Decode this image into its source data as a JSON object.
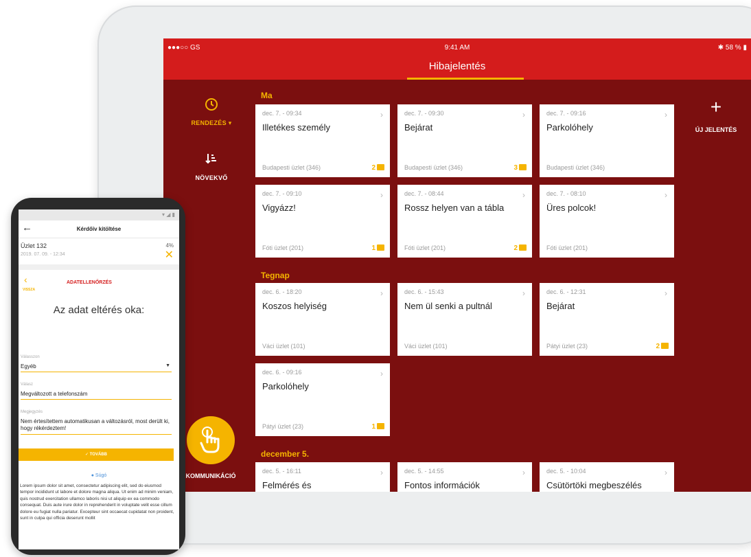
{
  "tablet": {
    "status": {
      "carrier": "●●●○○ GS",
      "time": "9:41 AM",
      "battery": "58 %"
    },
    "title": "Hibajelentés",
    "rail": {
      "sort_label": "RENDEZÉS",
      "order_label": "NÖVEKVŐ",
      "communication_label": "KOMMUNIKÁCIÓ"
    },
    "new_report_label": "ÚJ JELENTÉS",
    "sections": [
      {
        "heading": "Ma",
        "cards": [
          {
            "date": "dec. 7. - 09:34",
            "title": "Illetékes személy",
            "store": "Budapesti üzlet (346)",
            "badge": "2"
          },
          {
            "date": "dec. 7. - 09:30",
            "title": "Bejárat",
            "store": "Budapesti üzlet (346)",
            "badge": "3"
          },
          {
            "date": "dec. 7. - 09:16",
            "title": "Parkolóhely",
            "store": "Budapesti üzlet (346)",
            "badge": ""
          },
          {
            "date": "dec. 7. - 09:10",
            "title": "Vigyázz!",
            "store": "Fóti üzlet (201)",
            "badge": "1"
          },
          {
            "date": "dec. 7. - 08:44",
            "title": "Rossz helyen van a tábla",
            "store": "Fóti üzlet (201)",
            "badge": "2"
          },
          {
            "date": "dec. 7. - 08:10",
            "title": "Üres polcok!",
            "store": "Fóti üzlet (201)",
            "badge": ""
          }
        ]
      },
      {
        "heading": "Tegnap",
        "cards": [
          {
            "date": "dec. 6. - 18:20",
            "title": "Koszos helyiség",
            "store": "Váci üzlet (101)",
            "badge": ""
          },
          {
            "date": "dec. 6. - 15:43",
            "title": "Nem ül senki a pultnál",
            "store": "Váci üzlet (101)",
            "badge": ""
          },
          {
            "date": "dec. 6. - 12:31",
            "title": "Bejárat",
            "store": "Pátyi üzlet (23)",
            "badge": "2"
          },
          {
            "date": "dec. 6. - 09:16",
            "title": "Parkolóhely",
            "store": "Pátyi üzlet (23)",
            "badge": "1"
          }
        ]
      },
      {
        "heading": "december 5.",
        "cards": [
          {
            "date": "dec. 5. - 16:11",
            "title": "Felmérés és",
            "store": "",
            "badge": ""
          },
          {
            "date": "dec. 5. - 14:55",
            "title": "Fontos információk",
            "store": "",
            "badge": ""
          },
          {
            "date": "dec. 5. - 10:04",
            "title": "Csütörtöki megbeszélés",
            "store": "",
            "badge": ""
          }
        ]
      }
    ]
  },
  "phone": {
    "header_title": "Kérdőív kitöltése",
    "store": "Üzlet 132",
    "progress": "4%",
    "timestamp": "2019. 07. 09. - 12:34",
    "back_label": "VISSZA",
    "step_title": "ADATELLENŐRZÉS",
    "question": "Az adat eltérés oka:",
    "select_label": "Válasszon",
    "select_value": "Egyéb",
    "answer_label": "Válasz",
    "answer_value": "Megváltozott a telefonszám",
    "note_label": "Megjegyzés",
    "note_value": "Nem értesítettem automatikusan a változásról, most derült ki, hogy rékérdeztem!",
    "next_button": "✓ TOVÁBB",
    "help_label": "Súgó",
    "lorem": "Lorem ipsum dolor sit amet, consectetur adipiscing elit, sed do eiusmod tempor incididunt ut labore et dolore magna aliqua. Ut enim ad minim veniam, quis nostrud exercitation ullamco laboris nisi ut aliquip ex ea commodo consequat. Duis aute irure dolor in reprehenderit in voluptate velit esse cillum dolore eu fugiat nulla pariatur. Excepteur sint occaecat cupidatat non proident, sunt in culpa qui officia deserunt mollit"
  },
  "colors": {
    "brand_red": "#d41c1c",
    "dark_red": "#7b0f0f",
    "accent_yellow": "#f5b400"
  }
}
